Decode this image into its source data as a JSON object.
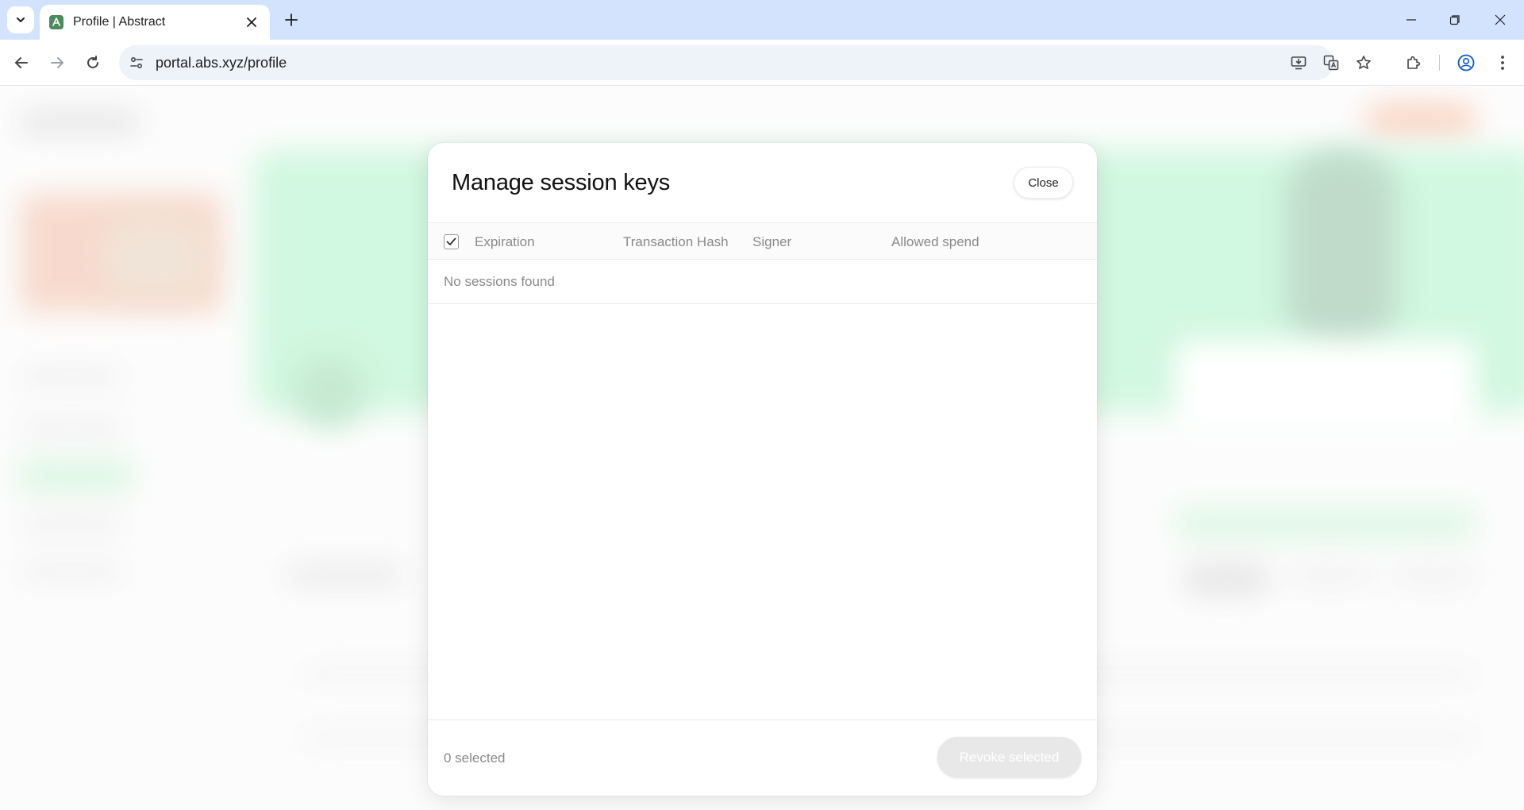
{
  "browser": {
    "tab_title": "Profile | Abstract",
    "url": "portal.abs.xyz/profile"
  },
  "modal": {
    "title": "Manage session keys",
    "close_label": "Close",
    "columns": [
      "Expiration",
      "Transaction Hash",
      "Signer",
      "Allowed spend"
    ],
    "select_all_checked": true,
    "empty_text": "No sessions found",
    "selected_count_text": "0 selected",
    "revoke_label": "Revoke selected",
    "revoke_disabled": true
  },
  "colors": {
    "tabstrip": "#d3e3fd",
    "page_accent_green": "#b9f4cf",
    "page_accent_orange": "#f7c9b2"
  }
}
